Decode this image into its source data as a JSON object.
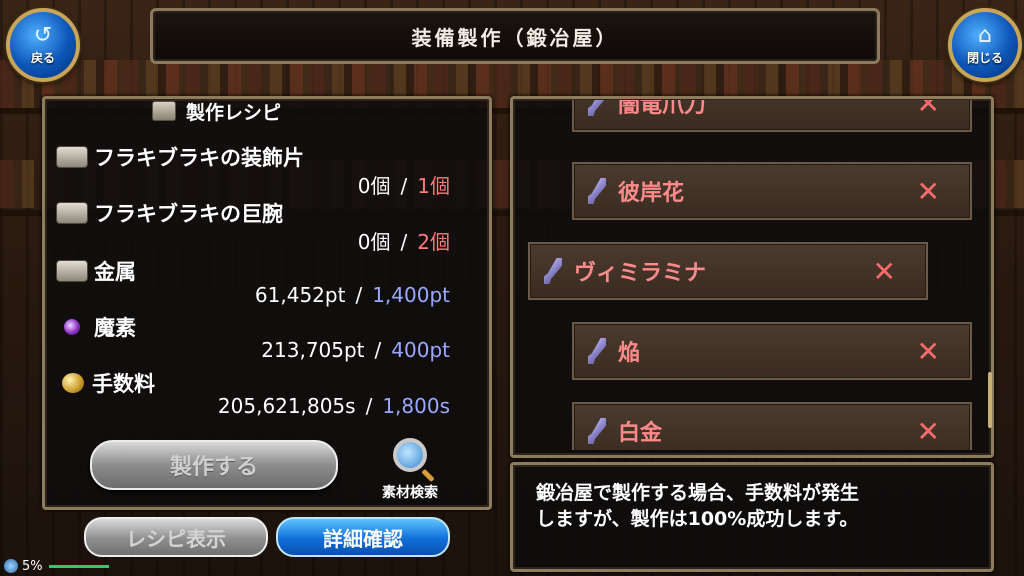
{
  "header": {
    "title": "装備製作（鍛冶屋）",
    "back_label": "戻る",
    "close_label": "閉じる"
  },
  "recipe": {
    "heading": "製作レシピ",
    "materials": [
      {
        "name": "フラキブラキの装飾片",
        "owned": "0個",
        "required": "1個",
        "icon": "ingot-icon",
        "req_color": "#ff7a7a"
      },
      {
        "name": "フラキブラキの巨腕",
        "owned": "0個",
        "required": "2個",
        "icon": "ingot-icon",
        "req_color": "#ff7a7a"
      },
      {
        "name": "金属",
        "owned": "61,452pt",
        "required": "1,400pt",
        "icon": "ingot-icon",
        "req_color": "#9aa8ff"
      },
      {
        "name": "魔素",
        "owned": "213,705pt",
        "required": "400pt",
        "icon": "orb-icon",
        "req_color": "#9aa8ff"
      },
      {
        "name": "手数料",
        "owned": "205,621,805s",
        "required": "1,800s",
        "icon": "coin-icon",
        "req_color": "#9aa8ff"
      }
    ],
    "separator": "/",
    "make_button": "製作する",
    "search_label": "素材検索"
  },
  "bottom_buttons": {
    "recipe_view": "レシピ表示",
    "detail_check": "詳細確認"
  },
  "equipment_list": [
    {
      "name": "闇竜爪刀",
      "mark": "✕"
    },
    {
      "name": "彼岸花",
      "mark": "✕"
    },
    {
      "name": "ヴィミラミナ",
      "mark": "✕"
    },
    {
      "name": "焔",
      "mark": "✕"
    },
    {
      "name": "白金",
      "mark": "✕"
    }
  ],
  "message": {
    "line1": "鍛冶屋で製作する場合、手数料が発生",
    "line2": "しますが、製作は100%成功します。"
  },
  "status": {
    "battery": "5%"
  }
}
